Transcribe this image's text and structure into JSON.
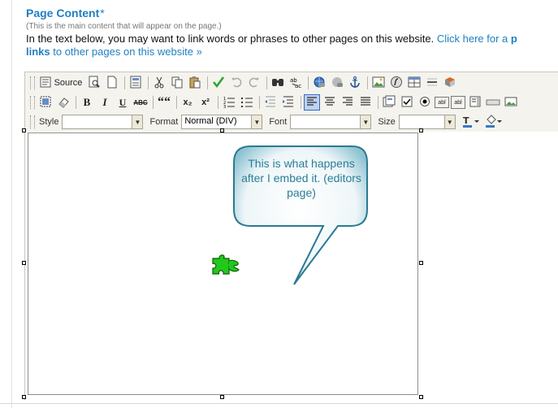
{
  "section": {
    "title": "Page Content",
    "required_mark": "*",
    "note": "(This is the main content that will appear on the page.)",
    "intro_text": "In the text below, you may want to link words or phrases to other pages on this website. ",
    "intro_link_start": "Click here for a ",
    "intro_link_bold_start": "p",
    "intro_link_bold_end": "links",
    "intro_link_end": " to other pages on this website »"
  },
  "toolbar": {
    "row1": [
      {
        "name": "source-button",
        "label": "Source",
        "icon": "source-icon"
      },
      {
        "name": "preview-button",
        "icon": "preview-icon"
      },
      {
        "name": "new-page-button",
        "icon": "new-page-icon"
      },
      {
        "name": "templates-button",
        "icon": "templates-icon"
      },
      {
        "name": "cut-button",
        "icon": "cut-icon"
      },
      {
        "name": "copy-button",
        "icon": "copy-icon"
      },
      {
        "name": "paste-button",
        "icon": "paste-icon"
      },
      {
        "name": "spellcheck-button",
        "icon": "spellcheck-icon"
      },
      {
        "name": "undo-button",
        "icon": "undo-icon"
      },
      {
        "name": "redo-button",
        "icon": "redo-icon"
      },
      {
        "name": "find-button",
        "icon": "find-icon"
      },
      {
        "name": "replace-button",
        "icon": "replace-icon"
      },
      {
        "name": "link-button",
        "icon": "link-icon"
      },
      {
        "name": "unlink-button",
        "icon": "unlink-icon"
      },
      {
        "name": "anchor-button",
        "icon": "anchor-icon"
      },
      {
        "name": "image-button",
        "icon": "image-icon"
      },
      {
        "name": "flash-button",
        "icon": "flash-icon"
      },
      {
        "name": "table-button",
        "icon": "table-icon"
      },
      {
        "name": "horizontal-rule-button",
        "icon": "horizontal-rule-icon"
      },
      {
        "name": "special-char-button",
        "icon": "special-char-icon"
      }
    ],
    "row2": [
      {
        "name": "select-all-button",
        "icon": "select-all-icon"
      },
      {
        "name": "remove-format-button",
        "icon": "eraser-icon"
      },
      {
        "name": "bold-button",
        "label": "B"
      },
      {
        "name": "italic-button",
        "label": "I"
      },
      {
        "name": "underline-button",
        "label": "U"
      },
      {
        "name": "strikethrough-button",
        "label": "ABC"
      },
      {
        "name": "blockquote-button",
        "label": "““"
      },
      {
        "name": "subscript-button",
        "label": "x₂"
      },
      {
        "name": "superscript-button",
        "label": "x²"
      },
      {
        "name": "numbered-list-button",
        "icon": "numbered-list-icon"
      },
      {
        "name": "bulleted-list-button",
        "icon": "bulleted-list-icon"
      },
      {
        "name": "outdent-button",
        "icon": "outdent-icon"
      },
      {
        "name": "indent-button",
        "icon": "indent-icon"
      },
      {
        "name": "align-left-button",
        "icon": "align-left-icon",
        "active": true
      },
      {
        "name": "align-center-button",
        "icon": "align-center-icon"
      },
      {
        "name": "align-right-button",
        "icon": "align-right-icon"
      },
      {
        "name": "justify-button",
        "icon": "justify-icon"
      },
      {
        "name": "form-button",
        "icon": "form-icon"
      },
      {
        "name": "checkbox-button",
        "icon": "checkbox-icon"
      },
      {
        "name": "radio-button",
        "icon": "radio-icon"
      },
      {
        "name": "textfield-button",
        "label": "abl"
      },
      {
        "name": "textarea-button",
        "label": "abl"
      },
      {
        "name": "select-field-button",
        "icon": "select-field-icon"
      },
      {
        "name": "button-field-button",
        "icon": "button-field-icon"
      },
      {
        "name": "image-button-field-button",
        "icon": "image-button-icon"
      }
    ],
    "style_label": "Style",
    "style_value": "",
    "format_label": "Format",
    "format_value": "Normal (DIV)",
    "font_label": "Font",
    "font_value": "",
    "size_label": "Size",
    "size_value": ""
  },
  "editor": {
    "callout_text": "This is what happens after I embed it. (editors page)",
    "plugin_icon": "puzzle-piece-icon"
  },
  "colors": {
    "heading": "#1f7fc3",
    "callout_text": "#2a7d98",
    "puzzle": "#22c81c",
    "active_button": "#c1d2ee"
  }
}
